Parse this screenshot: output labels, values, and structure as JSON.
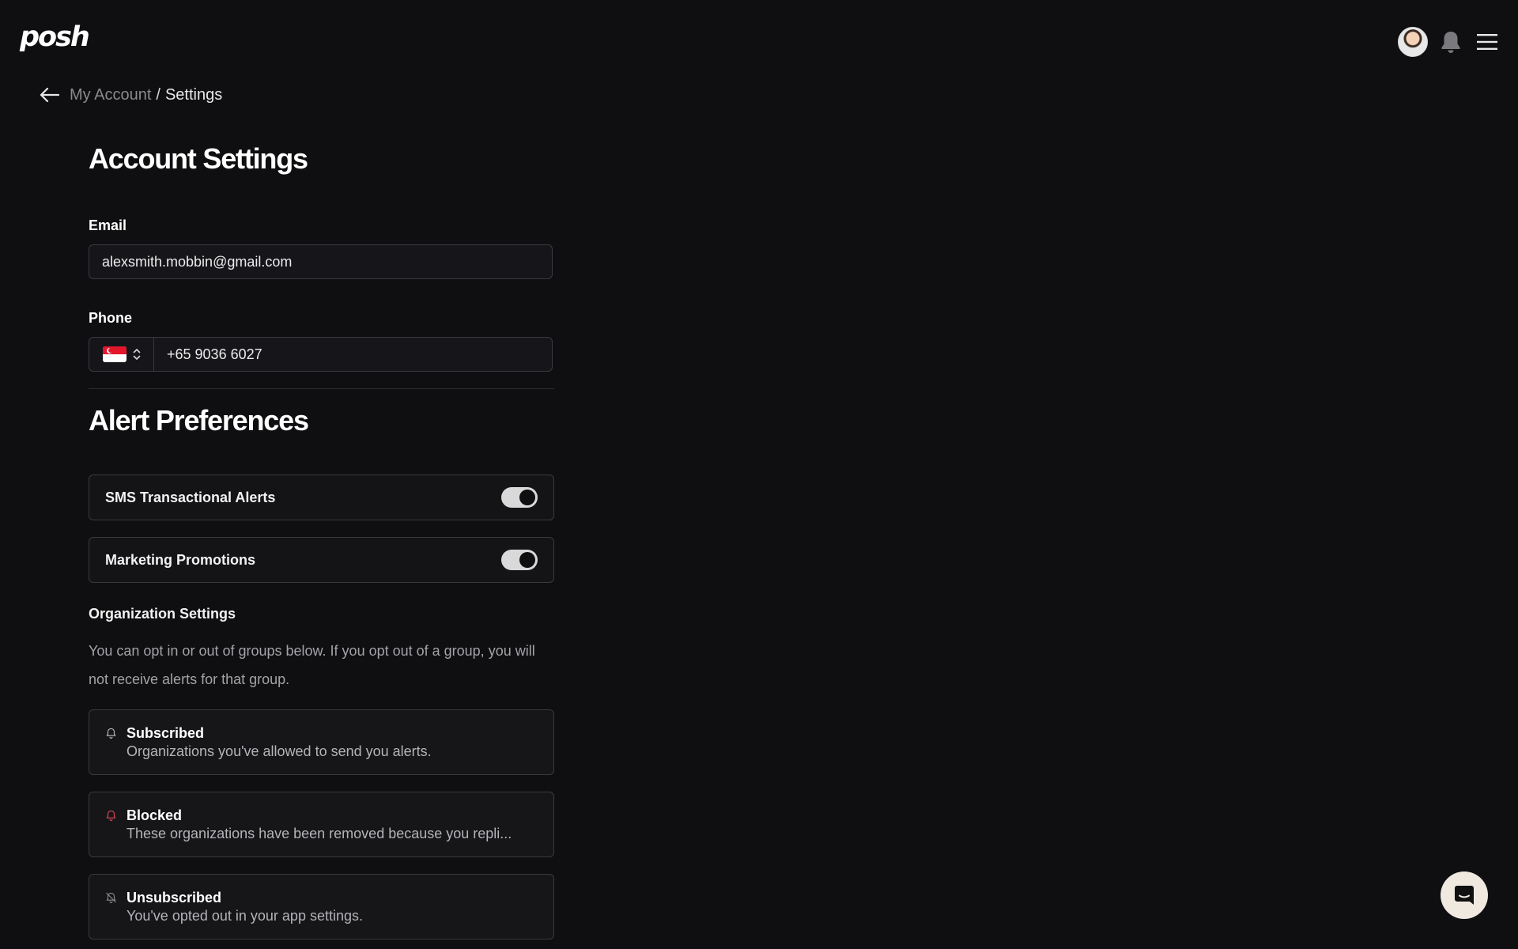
{
  "header": {
    "logo": "posh",
    "icons": [
      "avatar",
      "bell-icon",
      "menu-icon"
    ]
  },
  "breadcrumb": {
    "parent": "My Account",
    "separator": "/",
    "current": "Settings"
  },
  "account": {
    "title": "Account Settings",
    "email_label": "Email",
    "email_value": "alexsmith.mobbin@gmail.com",
    "phone_label": "Phone",
    "phone_value": "+65 9036 6027",
    "country": "Singapore"
  },
  "alerts": {
    "title": "Alert Preferences",
    "toggles": [
      {
        "label": "SMS Transactional Alerts",
        "on": true
      },
      {
        "label": "Marketing Promotions",
        "on": true
      }
    ]
  },
  "organization": {
    "title": "Organization Settings",
    "description": "You can opt in or out of groups below. If you opt out of a group, you will not receive alerts for that group.",
    "groups": [
      {
        "title": "Subscribed",
        "description": "Organizations you've allowed to send you alerts.",
        "icon": "bell-icon",
        "color": "#bdbdbd"
      },
      {
        "title": "Blocked",
        "description": "These organizations have been removed because you repli...",
        "icon": "bell-icon",
        "color": "#e0475a"
      },
      {
        "title": "Unsubscribed",
        "description": "You've opted out in your app settings.",
        "icon": "bell-off-icon",
        "color": "#8a8a8f"
      }
    ]
  },
  "colors": {
    "background": "#0f0f11",
    "accent_blocked": "#e0475a",
    "toggle_on": "#d9d9d9"
  }
}
